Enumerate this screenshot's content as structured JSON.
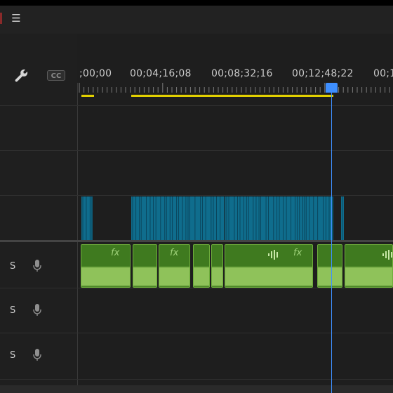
{
  "panel": {
    "menu_icon": "hamburger-menu-icon"
  },
  "toolbar": {
    "wrench_icon": "wrench-icon",
    "cc_label": "CC"
  },
  "timecodes": [
    ";00;00",
    "00;04;16;08",
    "00;08;32;16",
    "00;12;48;22",
    "00;1"
  ],
  "audio_tracks": [
    {
      "solo": "S",
      "mic_icon": "microphone-icon"
    },
    {
      "solo": "S",
      "mic_icon": "microphone-icon"
    },
    {
      "solo": "S",
      "mic_icon": "microphone-icon"
    }
  ],
  "clips": {
    "fx_label": "fx"
  },
  "colors": {
    "playhead": "#3e8fff",
    "video_clip": "#0f6d8d",
    "audio_clip": "#4f8a2a",
    "work_area": "#e2d000"
  }
}
